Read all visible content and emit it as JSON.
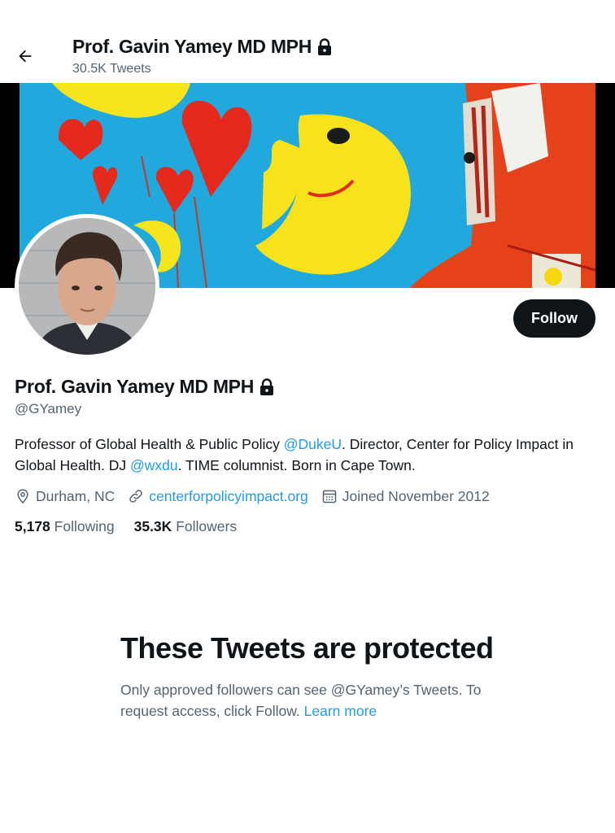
{
  "header": {
    "title": "Prof. Gavin Yamey MD MPH",
    "tweet_count": "30.5K Tweets"
  },
  "profile": {
    "name": "Prof. Gavin Yamey MD MPH",
    "handle": "@GYamey",
    "follow_label": "Follow",
    "bio": {
      "part1": "Professor of Global Health & Public Policy ",
      "mention1": "@DukeU",
      "part2": ". Director, Center for Policy Impact in Global Health. DJ ",
      "mention2": "@wxdu",
      "part3": ". TIME columnist. Born in Cape Town."
    },
    "location": "Durham, NC",
    "website": "centerforpolicyimpact.org",
    "joined": "Joined November 2012",
    "following_count": "5,178",
    "following_label": "Following",
    "followers_count": "35.3K",
    "followers_label": "Followers"
  },
  "protected": {
    "heading": "These Tweets are protected",
    "text": "Only approved followers can see @GYamey’s Tweets. To request access, click Follow.",
    "link": "Learn more"
  },
  "icons": {
    "back": "arrow-left-icon",
    "lock": "lock-icon",
    "location": "location-pin-icon",
    "link": "link-icon",
    "calendar": "calendar-icon"
  },
  "colors": {
    "accent": "#1d9bf0",
    "text": "#0f1419",
    "muted": "#536471",
    "follow_button": "#0f1419"
  }
}
